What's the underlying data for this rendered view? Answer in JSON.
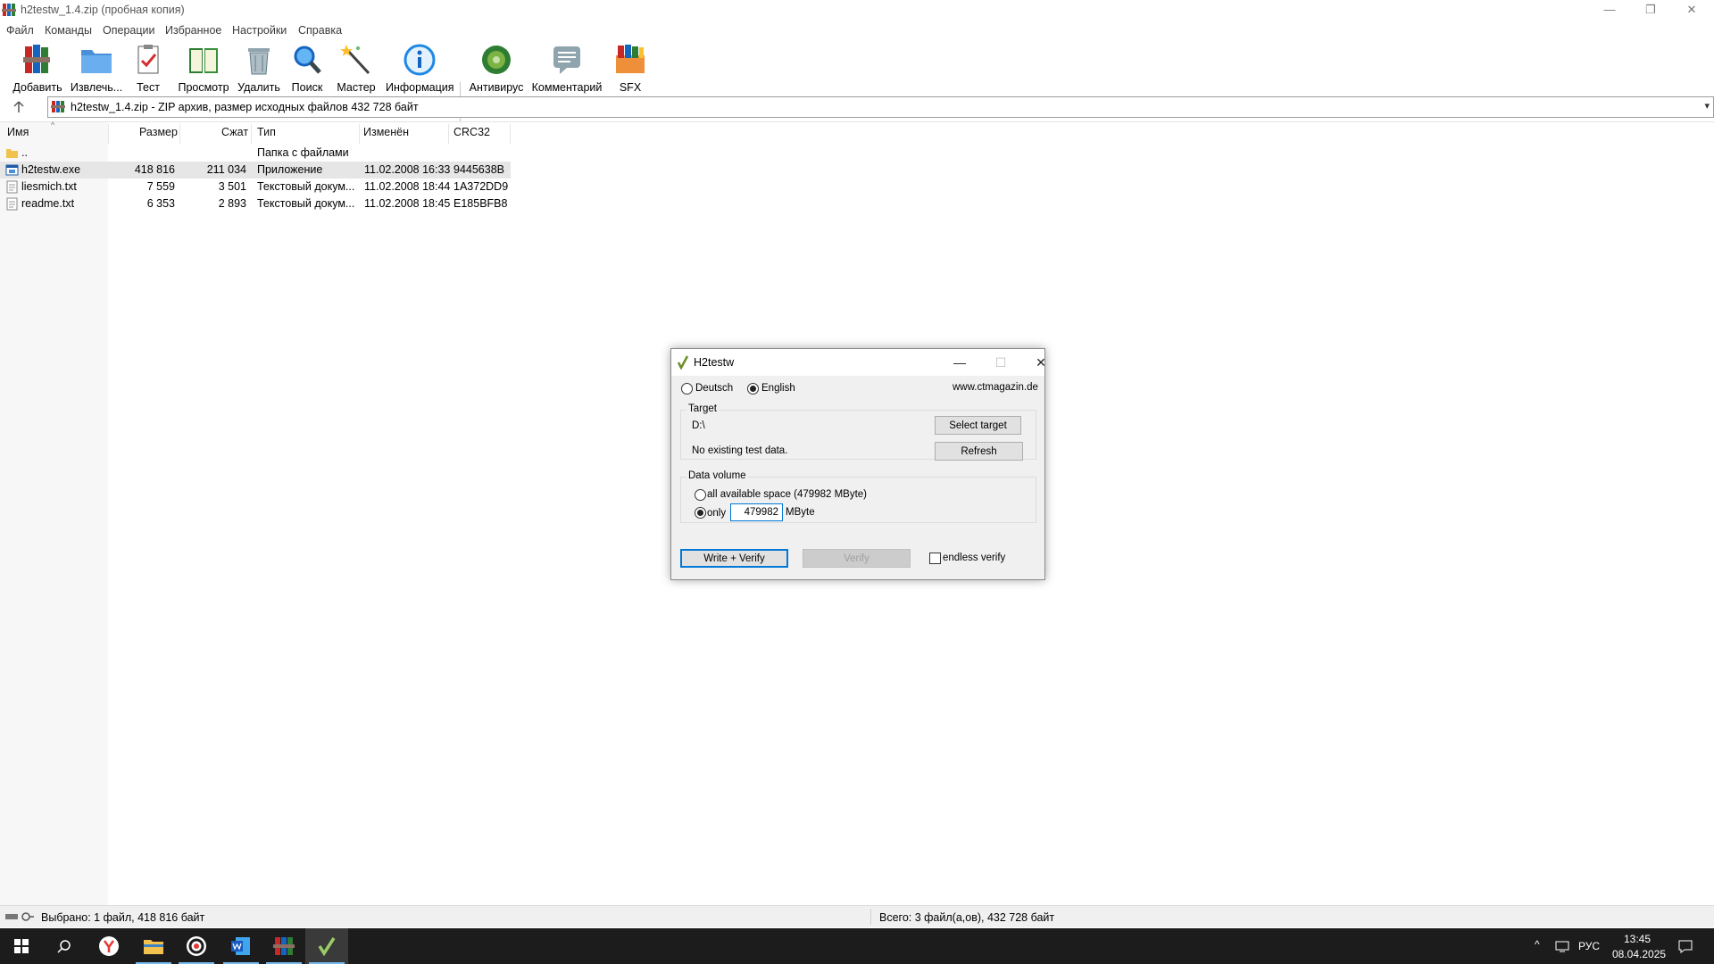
{
  "window": {
    "title": "h2testw_1.4.zip (пробная копия)",
    "controls": {
      "minimize": "—",
      "restore": "❐",
      "close": "✕"
    }
  },
  "menu": [
    "Файл",
    "Команды",
    "Операции",
    "Избранное",
    "Настройки",
    "Справка"
  ],
  "toolbar": [
    {
      "label": "Добавить",
      "icon": "books-add-icon"
    },
    {
      "label": "Извлечь...",
      "icon": "folder-extract-icon"
    },
    {
      "label": "Тест",
      "icon": "test-clipboard-icon"
    },
    {
      "label": "Просмотр",
      "icon": "book-view-icon"
    },
    {
      "label": "Удалить",
      "icon": "trash-icon"
    },
    {
      "label": "Поиск",
      "icon": "magnifier-icon"
    },
    {
      "label": "Мастер",
      "icon": "wizard-wand-icon"
    },
    {
      "label": "Информация",
      "icon": "info-icon"
    },
    {
      "label": "Антивирус",
      "icon": "antivirus-icon"
    },
    {
      "label": "Комментарий",
      "icon": "comment-icon"
    },
    {
      "label": "SFX",
      "icon": "sfx-books-icon"
    }
  ],
  "address": {
    "text": "h2testw_1.4.zip - ZIP архив, размер исходных файлов 432 728 байт"
  },
  "columns": [
    "Имя",
    "Размер",
    "Сжат",
    "Тип",
    "Изменён",
    "CRC32"
  ],
  "files": [
    {
      "name": "..",
      "size": "",
      "packed": "",
      "type": "Папка с файлами",
      "modified": "",
      "crc": "",
      "icon": "folder-icon",
      "selected": false
    },
    {
      "name": "h2testw.exe",
      "size": "418 816",
      "packed": "211 034",
      "type": "Приложение",
      "modified": "11.02.2008 16:33",
      "crc": "9445638B",
      "icon": "exe-file-icon",
      "selected": true
    },
    {
      "name": "liesmich.txt",
      "size": "7 559",
      "packed": "3 501",
      "type": "Текстовый докум...",
      "modified": "11.02.2008 18:44",
      "crc": "1A372DD9",
      "icon": "text-file-icon",
      "selected": false
    },
    {
      "name": "readme.txt",
      "size": "6 353",
      "packed": "2 893",
      "type": "Текстовый докум...",
      "modified": "11.02.2008 18:45",
      "crc": "E185BFB8",
      "icon": "text-file-icon",
      "selected": false
    }
  ],
  "status": {
    "left": "Выбрано: 1 файл, 418 816 байт",
    "right": "Всего: 3 файл(а,ов), 432 728 байт"
  },
  "taskbar": {
    "apps": [
      "start-icon",
      "search-icon",
      "yandex-icon",
      "file-explorer-icon",
      "chrome-icon",
      "word-icon",
      "winrar-icon",
      "h2testw-icon"
    ],
    "active_apps": [
      3,
      4,
      5,
      6,
      7
    ],
    "tray": {
      "language": "РУС",
      "time": "13:45",
      "date": "08.04.2025"
    }
  },
  "dialog": {
    "title": "H2testw",
    "lang_de": "Deutsch",
    "lang_en": "English",
    "lang_selected": "English",
    "website": "www.ctmagazin.de",
    "target_label": "Target",
    "target_path": "D:\\",
    "no_data": "No existing test data.",
    "select_target": "Select target",
    "refresh": "Refresh",
    "volume_label": "Data volume",
    "all_space": "all available space (479982 MByte)",
    "only": "only",
    "only_value": "479982",
    "unit": "MByte",
    "volume_selected": "only",
    "write_verify": "Write + Verify",
    "verify": "Verify",
    "endless": "endless verify",
    "endless_checked": false
  }
}
